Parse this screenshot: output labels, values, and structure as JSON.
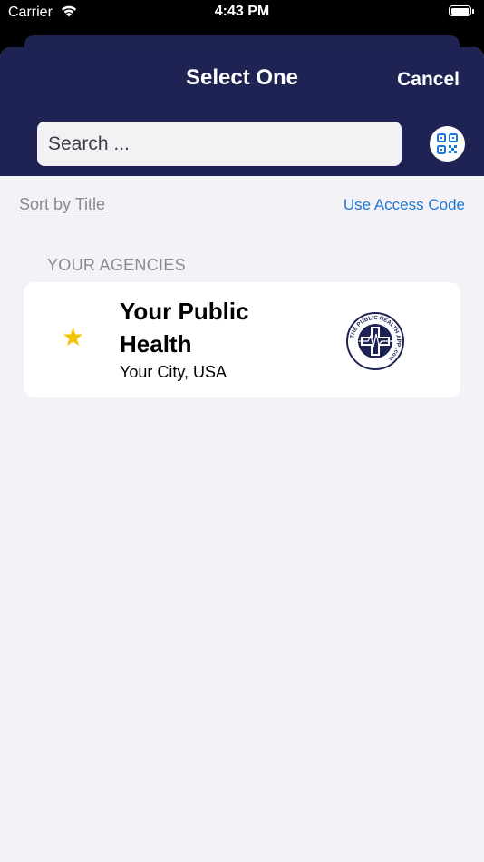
{
  "status_bar": {
    "carrier": "Carrier",
    "time": "4:43 PM",
    "wifi_icon": "wifi-icon",
    "battery_icon": "battery-icon"
  },
  "header": {
    "title": "Select One",
    "cancel_label": "Cancel",
    "background_color": "#1f2353"
  },
  "search": {
    "placeholder": "Search ...",
    "value": ""
  },
  "qr_button": {
    "icon": "qr-code-icon"
  },
  "sort": {
    "label": "Sort by Title"
  },
  "access_code": {
    "label": "Use Access Code",
    "color": "#1f77d4"
  },
  "agencies": {
    "section_title": "YOUR AGENCIES",
    "items": [
      {
        "name": "Your Public Health",
        "location": "Your City, USA",
        "favorite_icon": "star-icon",
        "favorite_color": "#f5c400",
        "logo_text": "THE PUBLIC HEALTH APP .com"
      }
    ]
  }
}
